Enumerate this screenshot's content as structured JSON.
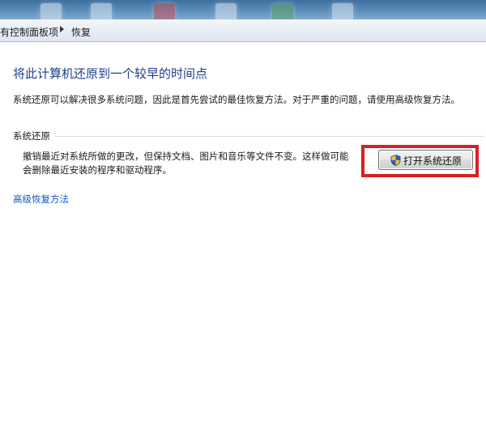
{
  "window": {
    "breadcrumb": {
      "parent": "有控制面板项",
      "current": "恢复"
    }
  },
  "main": {
    "title": "将此计算机还原到一个较早的时间点",
    "intro": "系统还原可以解决很多系统问题，因此是首先尝试的最佳恢复方法。对于严重的问题，请使用高级恢复方法。",
    "system_restore": {
      "section_label": "系统还原",
      "description_line1": "撤销最近对系统所做的更改，但保持文档、图片和音乐等文件不变。这样做可能",
      "description_line2": "会删除最近安装的程序和驱动程序。",
      "button_label": "打开系统还原",
      "button_icon": "uac-shield-icon"
    },
    "advanced_link": "高级恢复方法"
  },
  "colors": {
    "title": "#1e3d8a",
    "link": "#1155c4",
    "highlight": "#d91f26"
  }
}
